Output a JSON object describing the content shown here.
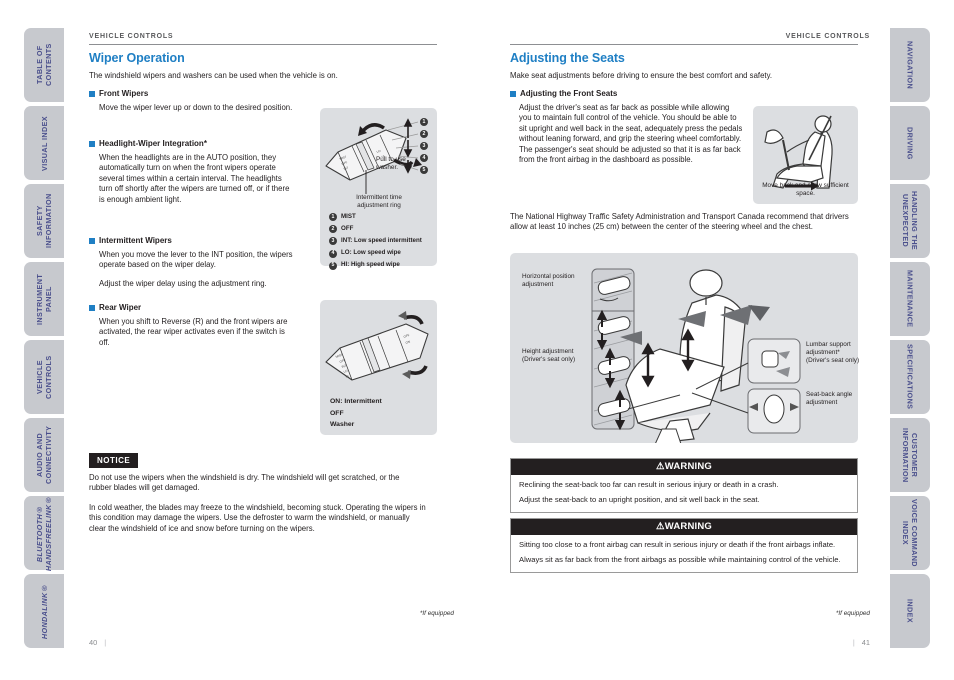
{
  "theme": {
    "accent": "#1f7fc4",
    "tab_bg": "#c7c9ce",
    "tab_text": "#4a4f8c",
    "figure_bg": "#dcdee1",
    "ink": "#231f20"
  },
  "tabs_left": [
    {
      "label": "TABLE OF CONTENTS",
      "italic": false
    },
    {
      "label": "VISUAL INDEX",
      "italic": false
    },
    {
      "label": "SAFETY INFORMATION",
      "italic": false
    },
    {
      "label": "INSTRUMENT PANEL",
      "italic": false
    },
    {
      "label": "VEHICLE CONTROLS",
      "italic": false
    },
    {
      "label": "AUDIO AND CONNECTIVITY",
      "italic": false
    },
    {
      "label": "BLUETOOTH® HANDSFREELINK®",
      "italic": true
    },
    {
      "label": "HONDALINK®",
      "italic": true
    }
  ],
  "tabs_right": [
    {
      "label": "NAVIGATION"
    },
    {
      "label": "DRIVING"
    },
    {
      "label": "HANDLING THE UNEXPECTED"
    },
    {
      "label": "MAINTENANCE"
    },
    {
      "label": "SPECIFICATIONS"
    },
    {
      "label": "CUSTOMER INFORMATION"
    },
    {
      "label": "VOICE COMMAND INDEX"
    },
    {
      "label": "INDEX"
    }
  ],
  "left_page": {
    "runhead": "VEHICLE CONTROLS",
    "title": "Wiper Operation",
    "intro": "The windshield wipers and washers can be used when the vehicle is on.",
    "front_wipers": {
      "heading": "Front Wipers",
      "body": "Move the wiper lever up or down to the desired position."
    },
    "headlight_wiper": {
      "heading": "Headlight-Wiper Integration*",
      "body": "When the headlights are in the AUTO position, they automatically turn on when the front wipers operate several times within a certain interval. The headlights turn off shortly after the wipers are turned off, or if there is enough ambient light."
    },
    "intermittent_wipers": {
      "heading": "Intermittent Wipers",
      "body1": "When you move the lever to the INT position, the wipers operate based on the wiper delay.",
      "body2": "Adjust the wiper delay using the adjustment ring."
    },
    "rear_wiper": {
      "heading": "Rear Wiper",
      "body": "When you shift to Reverse (R) and the front wipers are activated, the rear wiper activates even if the switch is off."
    },
    "stalk_figure": {
      "pull_label": "Pull to use washer.",
      "ring_label": "Intermittent time adjustment ring",
      "legend": [
        {
          "num": "1",
          "text": "MIST"
        },
        {
          "num": "2",
          "text": "OFF"
        },
        {
          "num": "3",
          "text": "INT: Low speed intermittent"
        },
        {
          "num": "4",
          "text": "LO: Low speed wipe"
        },
        {
          "num": "5",
          "text": "HI: High speed wipe"
        }
      ]
    },
    "rear_figure": {
      "lines": [
        "ON: Intermittent",
        "OFF",
        "Washer"
      ]
    },
    "notice": {
      "tag": "NOTICE",
      "p1": "Do not use the wipers when the windshield is dry. The windshield will get scratched, or the rubber blades will get damaged.",
      "p2": "In cold weather, the blades may freeze to the windshield, becoming stuck. Operating the wipers in this condition may damage the wipers. Use the defroster to warm the windshield, or manually clear the windshield of ice and snow before turning on the wipers."
    },
    "footnote": "*If equipped",
    "folio": "40"
  },
  "right_page": {
    "runhead": "VEHICLE CONTROLS",
    "title": "Adjusting the Seats",
    "intro": "Make seat adjustments before driving to ensure the best comfort and safety.",
    "front_seats": {
      "heading": "Adjusting the Front Seats",
      "body": "Adjust the driver's seat as far back as possible while allowing you to maintain full control of the vehicle. You should be able to sit upright and well back in the seat, adequately press the pedals without leaning forward, and grip the steering wheel comfortably. The passenger's seat should be adjusted so that it is as far back from the front airbag in the dashboard as possible.",
      "body2": "The National Highway Traffic Safety Administration and Transport Canada recommend that drivers allow at least 10 inches (25 cm) between the center of the steering wheel and the chest."
    },
    "driver_figure": {
      "caption": "Move back and allow sufficient space."
    },
    "seat_figure": {
      "label_horizontal": "Horizontal position adjustment",
      "label_height": "Height adjustment (Driver's seat only)",
      "label_lumbar": "Lumbar support adjustment* (Driver's seat only)",
      "label_seatback": "Seat-back angle adjustment"
    },
    "warnings": [
      {
        "title": "WARNING",
        "paragraphs": [
          "Reclining the seat-back too far can result in serious injury or death in a crash.",
          "Adjust the seat-back to an upright position, and sit well back in the seat."
        ]
      },
      {
        "title": "WARNING",
        "paragraphs": [
          "Sitting too close to a front airbag can result in serious injury or death if the front airbags inflate.",
          "Always sit as far back from the front airbags as possible while maintaining control of the vehicle."
        ]
      }
    ],
    "footnote": "*If equipped",
    "folio": "41"
  }
}
